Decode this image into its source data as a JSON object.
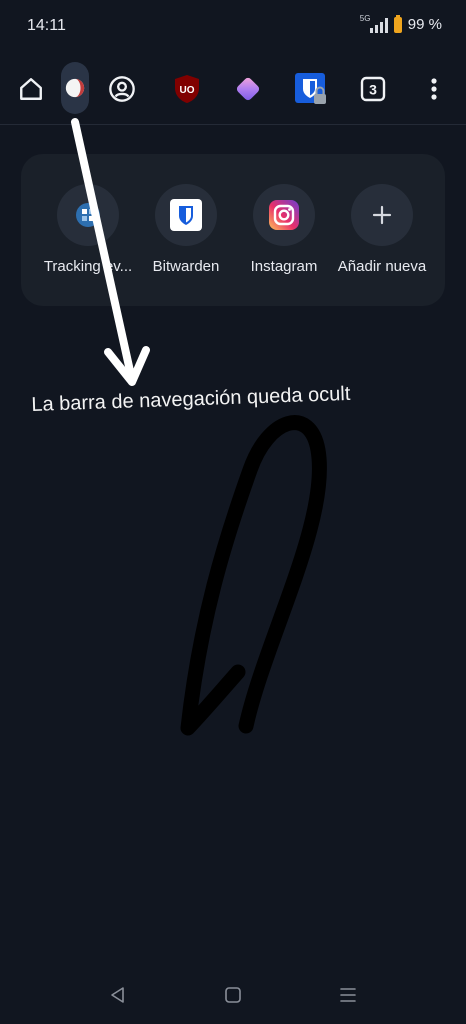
{
  "status_bar": {
    "time": "14:11",
    "network": "5G",
    "battery_text": "99 %"
  },
  "toolbar": {
    "home_icon": "home-icon",
    "active_tab_icon": "tracking-page-icon",
    "account_icon": "account-icon",
    "ublock_label": "UO",
    "extension_icon": "extension-icon",
    "bitwarden_icon": "bitwarden-locked-icon",
    "tab_count": "3",
    "menu_icon": "more-vert-icon"
  },
  "shortcuts": [
    {
      "label": "Tracking ev...",
      "icon": "tracking-icon"
    },
    {
      "label": "Bitwarden",
      "icon": "bitwarden-icon"
    },
    {
      "label": "Instagram",
      "icon": "instagram-icon"
    },
    {
      "label": "Añadir nueva",
      "icon": "plus-icon"
    }
  ],
  "annotation": {
    "text": "La barra de navegación queda ocult"
  },
  "colors": {
    "background": "#111620",
    "card": "#1a2029",
    "battery": "#f0a51e",
    "ublock": "#800000",
    "bitwarden": "#175DDC"
  }
}
